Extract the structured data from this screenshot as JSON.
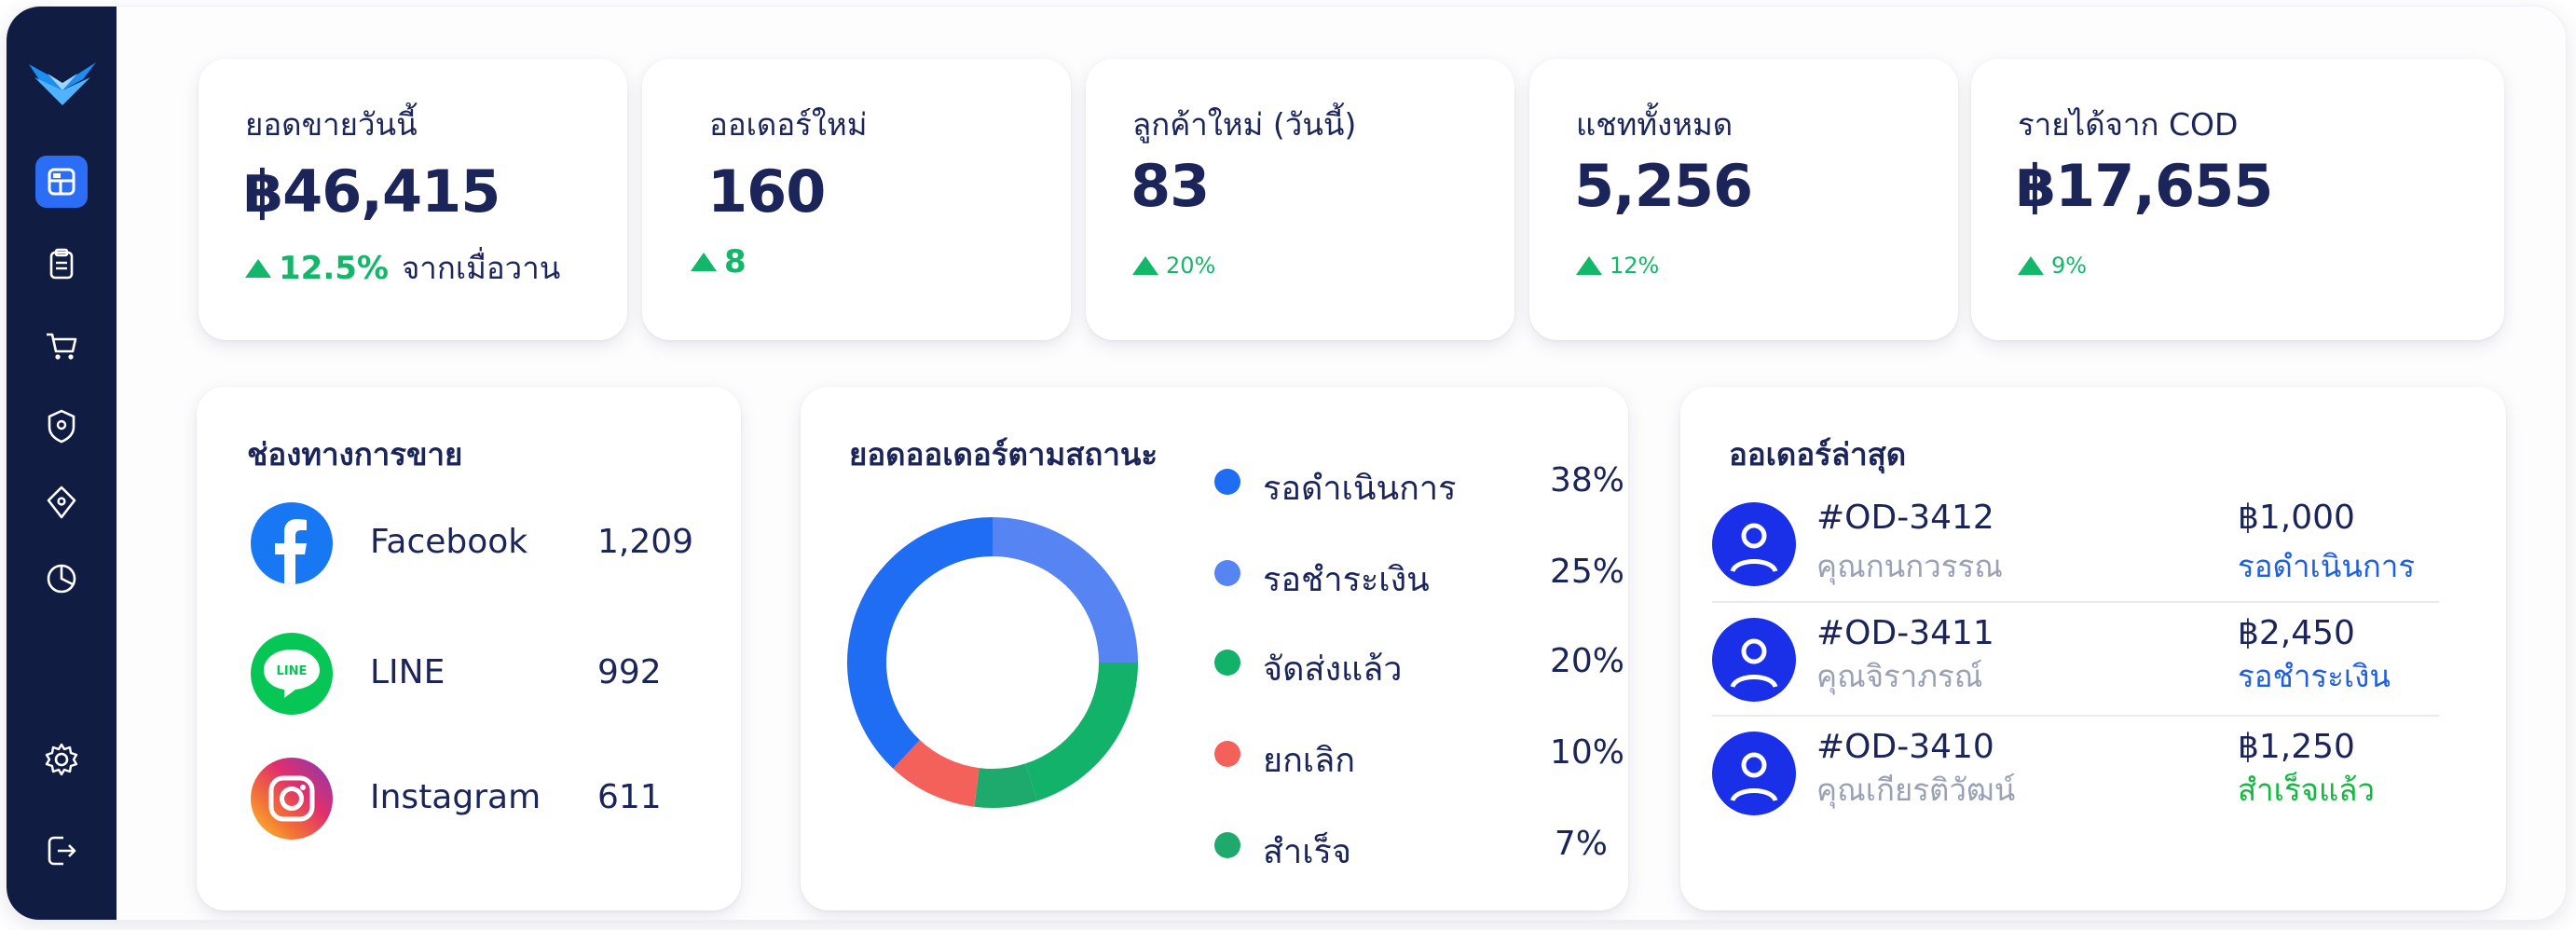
{
  "kpis": [
    {
      "title": "ยอดขายวันนี้",
      "value": "฿46,415",
      "delta": "12.5%",
      "delta_text": "จากเมื่อวาน"
    },
    {
      "title": "ออเดอร์ใหม่",
      "value": "160",
      "delta": "8",
      "delta_text": ""
    },
    {
      "title": "ลูกค้าใหม่ (วันนี้)",
      "value": "83",
      "delta": "20%",
      "delta_text": ""
    },
    {
      "title": "แชททั้งหมด",
      "value": "5,256",
      "delta": "12%",
      "delta_text": ""
    },
    {
      "title": "รายได้จาก COD",
      "value": "฿17,655",
      "delta": "9%",
      "delta_text": ""
    }
  ],
  "channels": {
    "title": "ช่องทางการขาย",
    "items": [
      {
        "name": "Facebook",
        "count": "1,209",
        "icon": "facebook-icon"
      },
      {
        "name": "LINE",
        "count": "992",
        "icon": "line-icon",
        "icon_text": "LINE"
      },
      {
        "name": "Instagram",
        "count": "611",
        "icon": "instagram-icon"
      }
    ]
  },
  "order_status": {
    "title": "ยอดออเดอร์ตามสถานะ",
    "items": [
      {
        "label": "รอดำเนินการ",
        "pct": "38%",
        "value": 38,
        "color": "#1f6df2"
      },
      {
        "label": "รอชำระเงิน",
        "pct": "25%",
        "value": 25,
        "color": "#5685f3"
      },
      {
        "label": "จัดส่งแล้ว",
        "pct": "20%",
        "value": 20,
        "color": "#12b26a"
      },
      {
        "label": "ยกเลิก",
        "pct": "10%",
        "value": 10,
        "color": "#f4605a"
      },
      {
        "label": "สำเร็จ",
        "pct": "7%",
        "value": 7,
        "color": "#1eaa6c"
      }
    ]
  },
  "recent_orders": {
    "title": "ออเดอร์ล่าสุด",
    "items": [
      {
        "id": "#OD-3412",
        "customer": "คุณกนกวรรณ",
        "amount": "฿1,000",
        "status": "รอดำเนินการ",
        "status_color": "#1f5fe0"
      },
      {
        "id": "#OD-3411",
        "customer": "คุณจิราภรณ์",
        "amount": "฿2,450",
        "status": "รอชำระเงิน",
        "status_color": "#1f5fe0"
      },
      {
        "id": "#OD-3410",
        "customer": "คุณเกียรติวัฒน์",
        "amount": "฿1,250",
        "status": "สำเร็จแล้ว",
        "status_color": "#12b83f"
      }
    ]
  },
  "sidebar": {
    "items": [
      "dashboard-icon",
      "clipboard-icon",
      "cart-icon",
      "shield-pin-icon",
      "tag-icon",
      "pie-chart-icon"
    ],
    "bottom": [
      "settings-icon",
      "logout-icon"
    ],
    "active_index": 0
  },
  "colors": {
    "sidebar": "#111c43",
    "accent": "#2b6ef5",
    "positive": "#12b76a",
    "text": "#1b2559"
  }
}
